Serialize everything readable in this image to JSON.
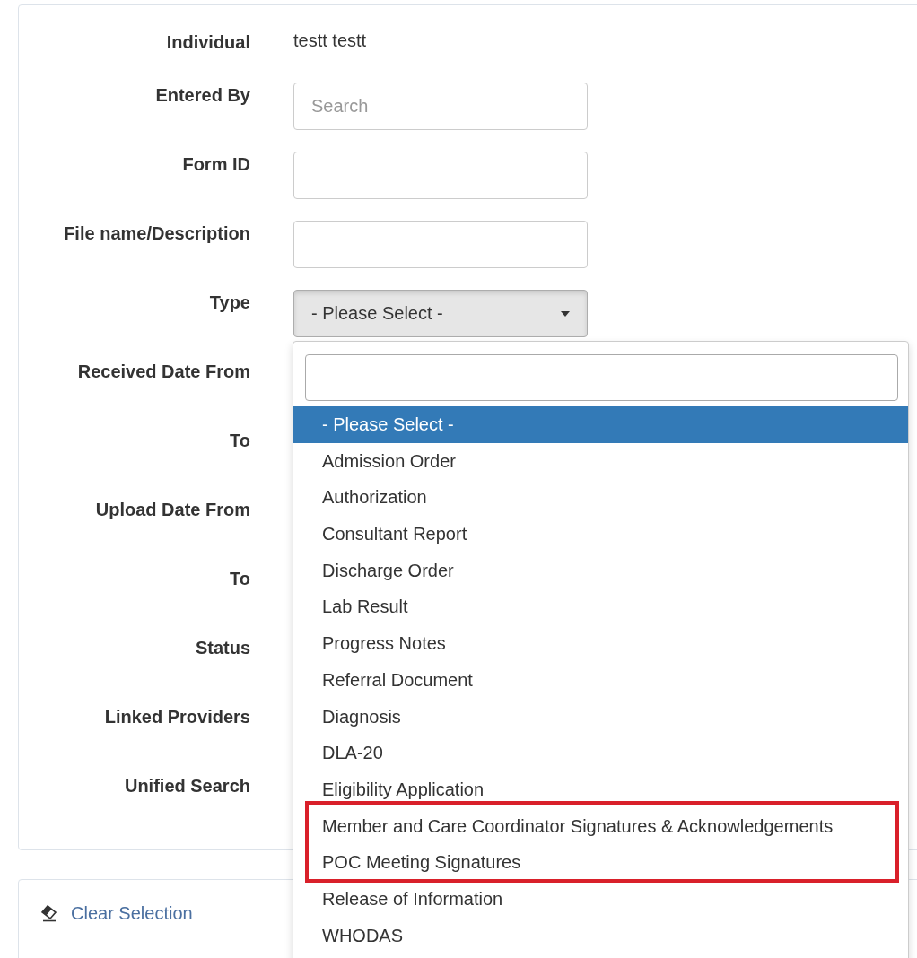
{
  "form": {
    "rows": [
      {
        "label": "Individual",
        "kind": "text",
        "value": "testt testt"
      },
      {
        "label": "Entered By",
        "kind": "input",
        "placeholder": "Search"
      },
      {
        "label": "Form ID",
        "kind": "input"
      },
      {
        "label": "File name/Description",
        "kind": "input"
      },
      {
        "label": "Type",
        "kind": "select",
        "value": "- Please Select -",
        "open": true
      },
      {
        "label": "Received Date From",
        "kind": "hidden"
      },
      {
        "label": "To",
        "kind": "hidden"
      },
      {
        "label": "Upload Date From",
        "kind": "hidden"
      },
      {
        "label": "To",
        "kind": "hidden"
      },
      {
        "label": "Status",
        "kind": "hidden"
      },
      {
        "label": "Linked Providers",
        "kind": "hidden"
      },
      {
        "label": "Unified Search",
        "kind": "hidden"
      }
    ]
  },
  "type_dropdown": {
    "options": [
      {
        "label": "- Please Select -",
        "selected": true,
        "highlighted": false
      },
      {
        "label": "Admission Order",
        "selected": false,
        "highlighted": false
      },
      {
        "label": "Authorization",
        "selected": false,
        "highlighted": false
      },
      {
        "label": "Consultant Report",
        "selected": false,
        "highlighted": false
      },
      {
        "label": "Discharge Order",
        "selected": false,
        "highlighted": false
      },
      {
        "label": "Lab Result",
        "selected": false,
        "highlighted": false
      },
      {
        "label": "Progress Notes",
        "selected": false,
        "highlighted": false
      },
      {
        "label": "Referral Document",
        "selected": false,
        "highlighted": false
      },
      {
        "label": "Diagnosis",
        "selected": false,
        "highlighted": false
      },
      {
        "label": "DLA-20",
        "selected": false,
        "highlighted": false
      },
      {
        "label": "Eligibility Application",
        "selected": false,
        "highlighted": false
      },
      {
        "label": "Member and Care Coordinator Signatures & Acknowledgements",
        "selected": false,
        "highlighted": true
      },
      {
        "label": "POC Meeting Signatures",
        "selected": false,
        "highlighted": true
      },
      {
        "label": "Release of Information",
        "selected": false,
        "highlighted": false
      },
      {
        "label": "WHODAS",
        "selected": false,
        "highlighted": false
      }
    ]
  },
  "actions": {
    "clear_selection": "Clear Selection"
  }
}
